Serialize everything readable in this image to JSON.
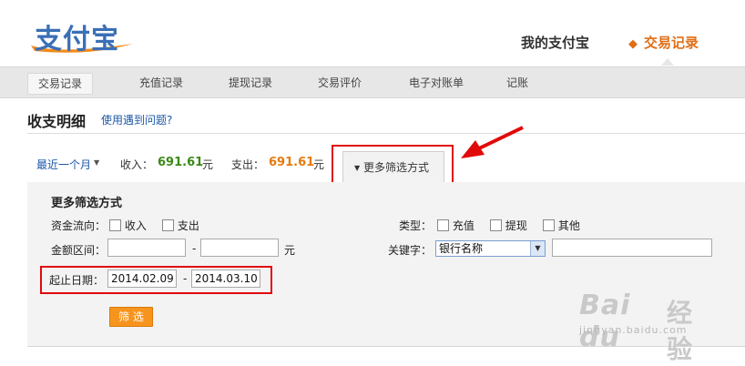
{
  "header": {
    "logo_text": "支付宝",
    "nav_my": "我的支付宝",
    "nav_trade": "交易记录"
  },
  "subnav": {
    "items": [
      {
        "label": "交易记录"
      },
      {
        "label": "充值记录"
      },
      {
        "label": "提现记录"
      },
      {
        "label": "交易评价"
      },
      {
        "label": "电子对账单"
      },
      {
        "label": "记账"
      }
    ]
  },
  "page": {
    "title": "收支明细",
    "help_link": "使用遇到问题?"
  },
  "summary": {
    "range": "最近一个月",
    "income_label": "收入：",
    "income_value": "691.61",
    "income_unit": "元",
    "expense_label": "支出：",
    "expense_value": "691.61",
    "expense_unit": "元",
    "more_filters_tab": "更多筛选方式"
  },
  "filters": {
    "title": "更多筛选方式",
    "flow_label": "资金流向：",
    "flow_in": "收入",
    "flow_out": "支出",
    "type_label": "类型：",
    "type_recharge": "充值",
    "type_withdraw": "提现",
    "type_other": "其他",
    "amount_label": "金额区间：",
    "amount_sep": "-",
    "amount_unit": "元",
    "keyword_label": "关键字：",
    "keyword_select": "银行名称",
    "date_label": "起止日期：",
    "date_start": "2014.02.09",
    "date_sep": "-",
    "date_end": "2014.03.10",
    "submit": "筛 选"
  },
  "watermark": {
    "brand": "Bai du",
    "cn": "经验",
    "url": "jingyan.baidu.com"
  },
  "colors": {
    "accent_orange": "#e06f17",
    "income_green": "#3a8a18",
    "expense_orange": "#e47a0c",
    "link_blue": "#1d58a8",
    "annotation_red": "#e10a0a"
  }
}
